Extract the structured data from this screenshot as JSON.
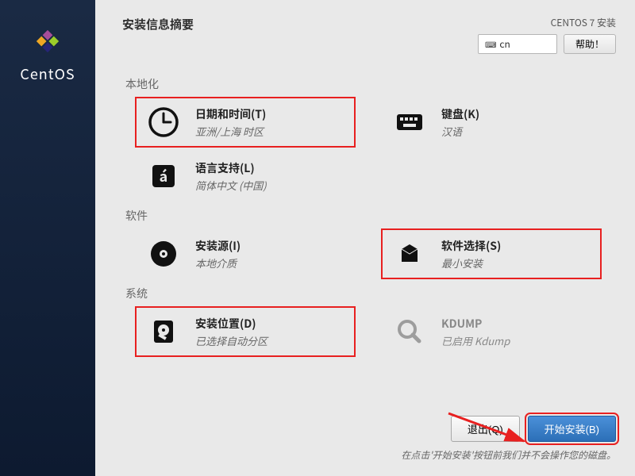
{
  "brand": "CentOS",
  "header": {
    "title": "安装信息摘要",
    "subtitle": "CENTOS 7 安装",
    "lang_indicator": "cn",
    "help_label": "帮助！"
  },
  "sections": {
    "localization": {
      "title": "本地化",
      "datetime": {
        "label": "日期和时间(T)",
        "value": "亚洲/上海 时区"
      },
      "keyboard": {
        "label": "键盘(K)",
        "value": "汉语"
      },
      "langsupport": {
        "label": "语言支持(L)",
        "value": "简体中文 (中国)"
      }
    },
    "software": {
      "title": "软件",
      "source": {
        "label": "安装源(I)",
        "value": "本地介质"
      },
      "selection": {
        "label": "软件选择(S)",
        "value": "最小安装"
      }
    },
    "system": {
      "title": "系统",
      "destination": {
        "label": "安装位置(D)",
        "value": "已选择自动分区"
      },
      "kdump": {
        "label": "KDUMP",
        "value": "已启用 Kdump"
      }
    }
  },
  "footer": {
    "quit_label": "退出(Q)",
    "begin_label": "开始安装(B)",
    "hint": "在点击'开始安装'按钮前我们并不会操作您的磁盘。"
  }
}
